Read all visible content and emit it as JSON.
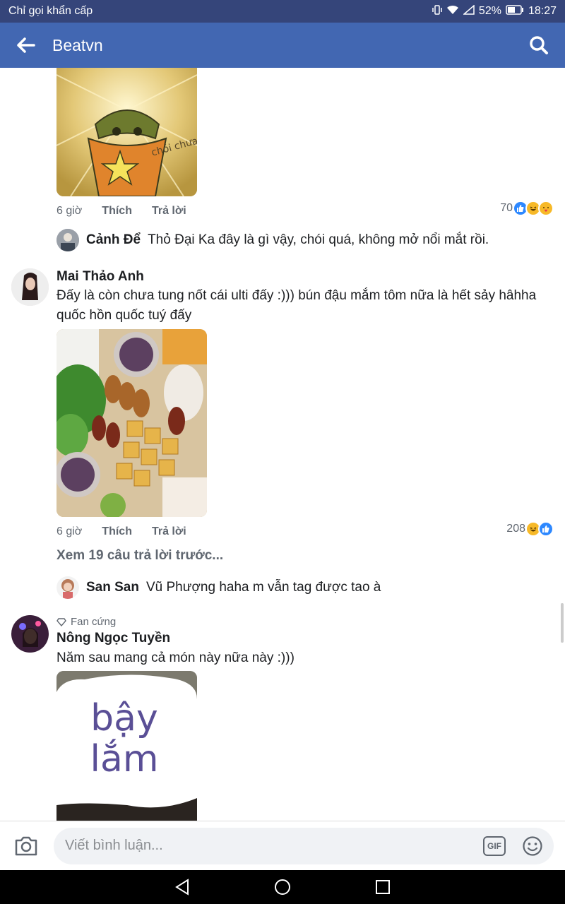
{
  "status_bar": {
    "carrier": "Chỉ gọi khẩn cấp",
    "battery": "52%",
    "time": "18:27"
  },
  "header": {
    "title": "Beatvn"
  },
  "comments": [
    {
      "time": "6 giờ",
      "like": "Thích",
      "reply": "Trả lời",
      "reactions_count": "70",
      "reactions": [
        "like-icon",
        "haha-icon",
        "love-icon"
      ],
      "image_caption": "chói chưa?",
      "reply_preview": {
        "name": "Cảnh Để",
        "text": "Thỏ Đại Ka  đây là gì vậy, chói quá, không mở nổi mắt rồi."
      }
    },
    {
      "name": "Mai Thảo Anh",
      "text": "Đấy là còn chưa tung nốt cái ulti đấy :))) bún đậu mắm tôm nữa là hết sảy hâhha quốc hồn quốc tuý đấy",
      "time": "6 giờ",
      "like": "Thích",
      "reply": "Trả lời",
      "reactions_count": "208",
      "reactions": [
        "haha-icon",
        "like-icon"
      ],
      "view_more": "Xem 19 câu trả lời trước...",
      "reply_preview": {
        "name": "San San",
        "text": "Vũ Phượng  haha m vẫn tag được tao à"
      }
    },
    {
      "badge": "Fan cứng",
      "name": "Nông Ngọc Tuyền",
      "text": "Năm sau mang cả món này nữa này :)))",
      "image_text": "bậy lắm"
    }
  ],
  "composer": {
    "placeholder": "Viết bình luận...",
    "gif_label": "GIF"
  },
  "colors": {
    "header_bg": "#4267b2",
    "status_bg": "#35457a",
    "like_blue": "#2d88ff",
    "haha_yellow": "#f7b928"
  }
}
